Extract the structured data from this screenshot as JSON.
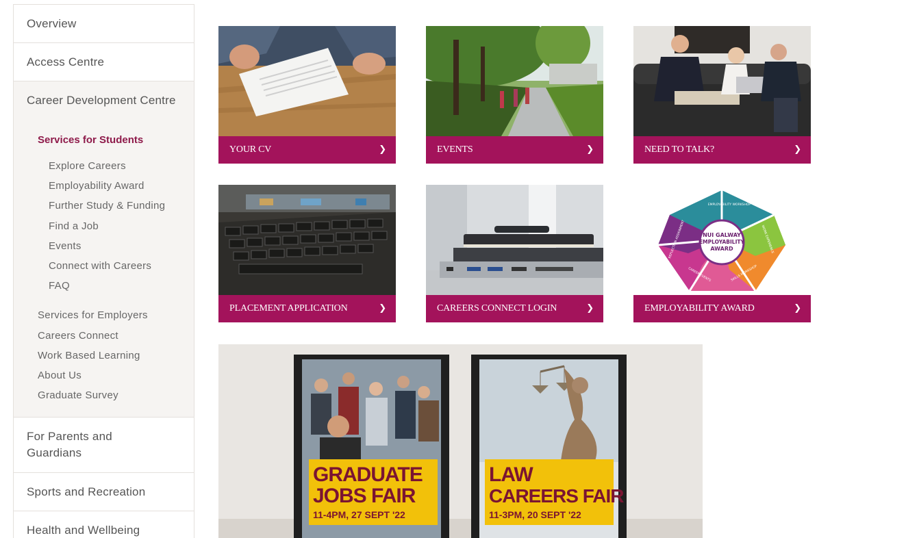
{
  "sidebar": {
    "overview": "Overview",
    "access_centre": "Access Centre",
    "career_dev": "Career Development Centre",
    "services_students": "Services for Students",
    "student_items": [
      "Explore Careers",
      "Employability Award",
      "Further Study & Funding",
      "Find a Job",
      "Events",
      "Connect with Careers",
      "FAQ"
    ],
    "other_items": [
      "Services for Employers",
      "Careers Connect",
      "Work Based Learning",
      "About Us",
      "Graduate Survey"
    ],
    "parents": "For Parents and Guardians",
    "sports": "Sports and Recreation",
    "health": "Health and Wellbeing"
  },
  "tiles": [
    {
      "label": "YOUR CV",
      "icon": "chevron-right-icon"
    },
    {
      "label": "EVENTS",
      "icon": "chevron-right-icon"
    },
    {
      "label": "NEED TO TALK?",
      "icon": "chevron-right-icon"
    },
    {
      "label": "PLACEMENT APPLICATION",
      "icon": "chevron-right-icon"
    },
    {
      "label": "CAREERS CONNECT LOGIN",
      "icon": "chevron-right-icon"
    },
    {
      "label": "EMPLOYABILITY AWARD",
      "icon": "chevron-right-icon"
    }
  ],
  "award": {
    "center": [
      "NUI GALWAY",
      "EMPLOYABILITY",
      "AWARD"
    ],
    "segments": [
      "EMPLOYABILITY WORKSHOP",
      "SKILLS WORKSHOP",
      "CAREER EVENTS",
      "REFLECTION ASSIGNMENT",
      "WORK EXPERIENCE"
    ]
  },
  "posters": [
    {
      "line1": "GRADUATE",
      "line2": "JOBS FAIR",
      "detail": "11-4PM, 27 SEPT '22"
    },
    {
      "line1": "LAW",
      "line2": "CAREERS FAIR",
      "detail": "11-3PM, 20 SEPT '22"
    }
  ],
  "colors": {
    "brand": "#a3135b",
    "active": "#8e1a4a",
    "poster_yellow": "#f2c10a",
    "poster_text": "#7a1432"
  }
}
